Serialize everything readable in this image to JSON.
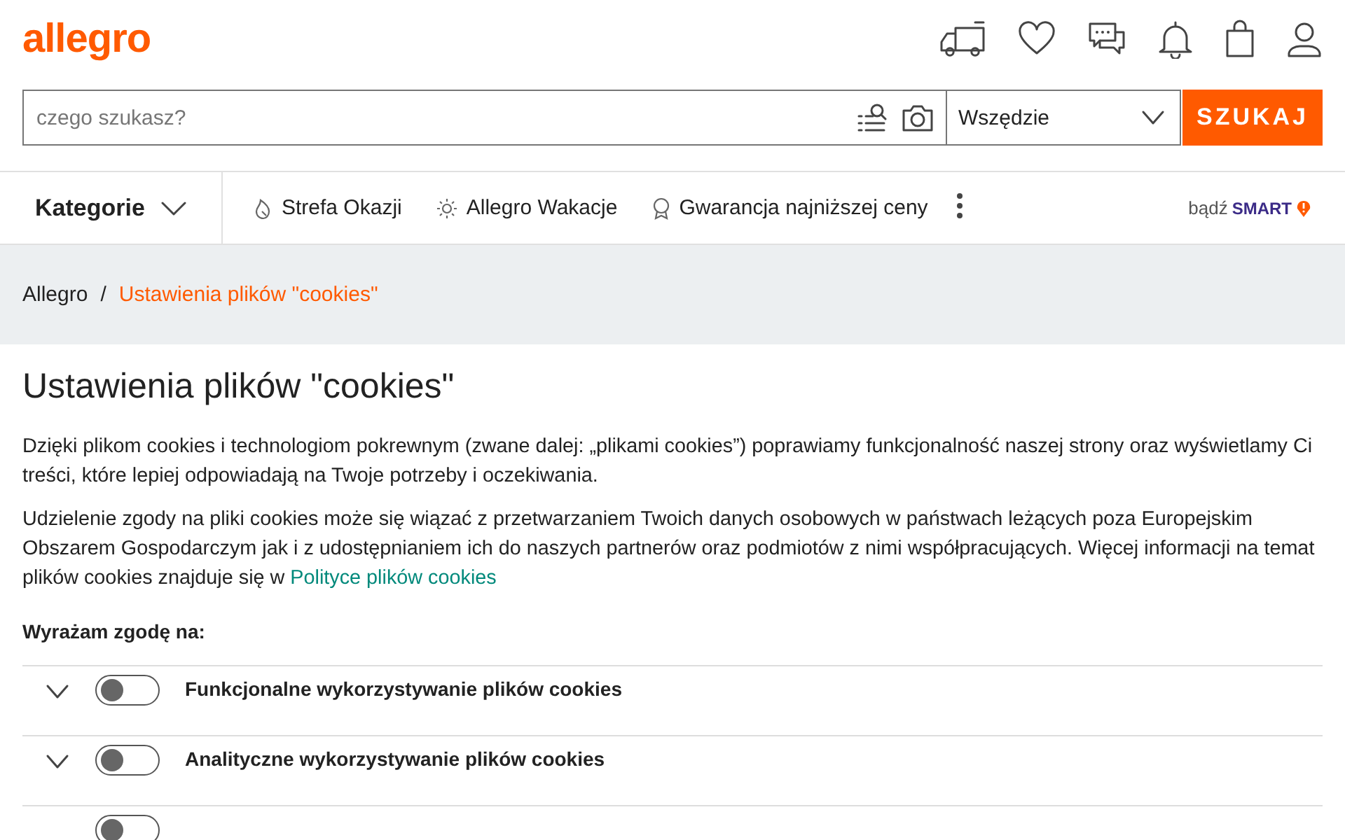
{
  "header": {
    "logo": "allegro",
    "search": {
      "placeholder": "czego szukasz?",
      "scope": "Wszędzie",
      "button": "SZUKAJ"
    }
  },
  "nav": {
    "categories": "Kategorie",
    "links": [
      {
        "label": "Strefa Okazji"
      },
      {
        "label": "Allegro Wakacje"
      },
      {
        "label": "Gwarancja najniższej ceny"
      }
    ],
    "smart": {
      "prefix": "bądź",
      "brand": "SMART"
    }
  },
  "breadcrumb": {
    "separator": "/",
    "items": [
      {
        "label": "Allegro",
        "selected": false
      },
      {
        "label": "Ustawienia plików \"cookies\"",
        "selected": true
      }
    ]
  },
  "page": {
    "title": "Ustawienia plików \"cookies\"",
    "paragraphs": [
      {
        "text": "Dzięki plikom cookies i technologiom pokrewnym (zwane dalej: „plikami cookies”) poprawiamy funkcjonalność naszej strony oraz wyświetlamy Ci treści, które lepiej odpowiadają na Twoje potrzeby i oczekiwania."
      },
      {
        "text": "Udzielenie zgody na pliki cookies może się wiązać z przetwarzaniem Twoich danych osobowych w państwach leżących poza Europejskim Obszarem Gospodarczym jak i z udostępnianiem ich do naszych partnerów oraz podmiotów z nimi współpracujących. Więcej informacji na temat plików cookies znajduje się w",
        "link": "Polityce plików cookies"
      }
    ],
    "consent_label": "Wyrażam zgodę na:",
    "options": [
      {
        "label": "Funkcjonalne wykorzystywanie plików cookies",
        "on": false,
        "expanded": false
      },
      {
        "label": "Analityczne wykorzystywanie plików cookies",
        "on": false,
        "expanded": false
      },
      {
        "on": false
      }
    ]
  }
}
